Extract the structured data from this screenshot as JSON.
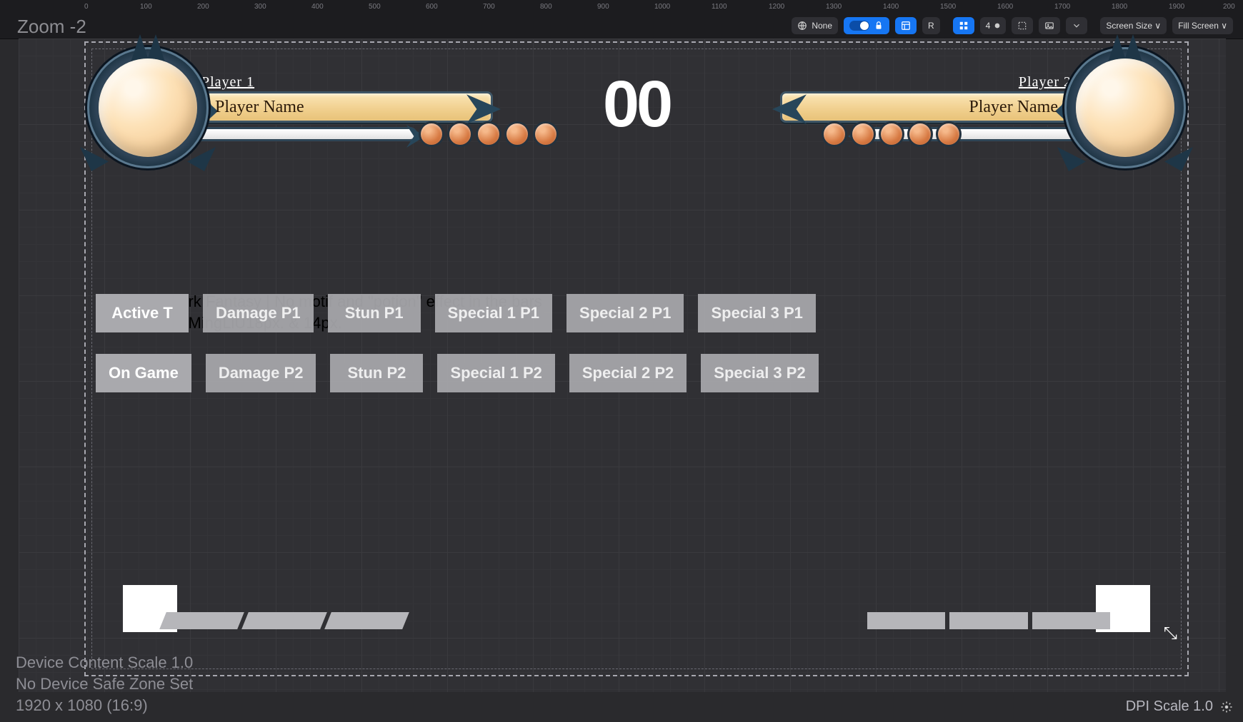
{
  "editor": {
    "zoom_label": "Zoom -2",
    "ruler_marks": [
      "0",
      "100",
      "200",
      "300",
      "400",
      "500",
      "600",
      "700",
      "800",
      "900",
      "1000",
      "1100",
      "1200",
      "1300",
      "1400",
      "1500",
      "1600",
      "1700",
      "1800",
      "1900",
      "200"
    ],
    "toolbar": {
      "localize": "None",
      "screensize": "Screen Size ∨",
      "fillscreen": "Fill Screen ∨",
      "letter_r": "R",
      "grid_count": "4"
    },
    "footer_line1": "Device Content Scale 1.0",
    "footer_line2": "No Device Safe Zone Set",
    "footer_line3": "1920 x 1080 (16:9)",
    "dpi_label": "DPI Scale 1.0"
  },
  "hud": {
    "timer": "00",
    "p1": {
      "tag": "Player 1",
      "name": "Player Name",
      "orb_count": 5
    },
    "p2": {
      "tag": "Player 2",
      "name": "Player Name",
      "orb_count": 5
    }
  },
  "note": {
    "line1": "Simple Dark Fantasy | No motif and \"potion\" effect in the bars",
    "line2": "Typeface: MingLiU18px. & 14px."
  },
  "debug": {
    "row1": [
      "Active T",
      "Damage P1",
      "Stun P1",
      "Special 1 P1",
      "Special 2 P1",
      "Special 3 P1"
    ],
    "row2": [
      "On Game",
      "Damage P2",
      "Stun P2",
      "Special 1 P2",
      "Special 2 P2",
      "Special 3 P2"
    ]
  },
  "combo": {
    "segments": 3
  }
}
